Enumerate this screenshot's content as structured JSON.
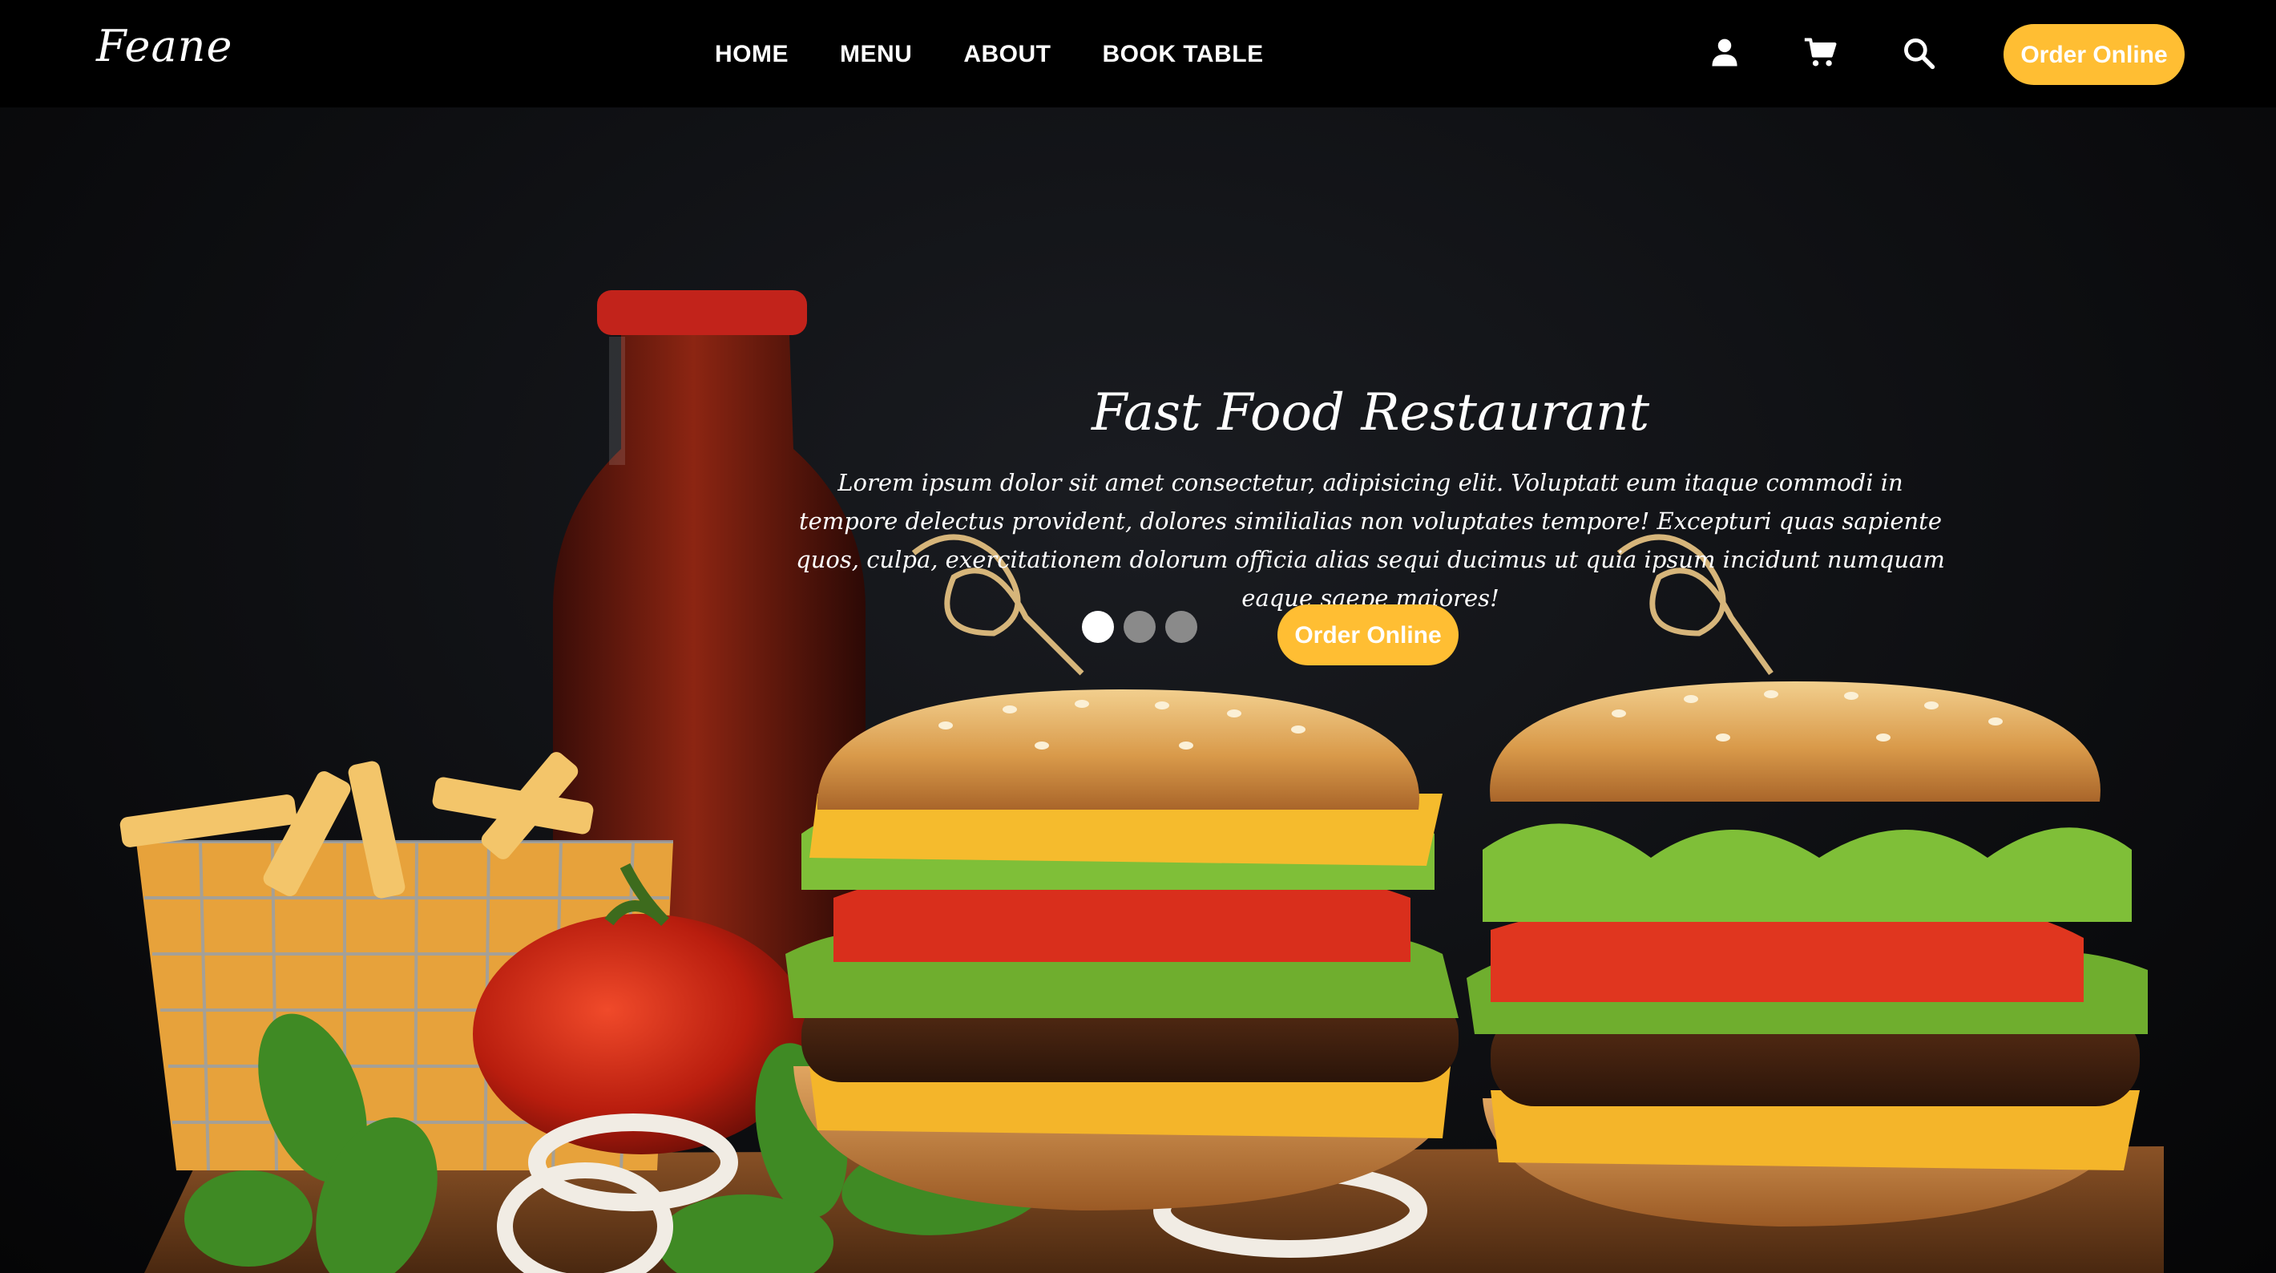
{
  "brand": {
    "name": "Feane"
  },
  "nav": {
    "items": [
      {
        "label": "HOME"
      },
      {
        "label": "MENU"
      },
      {
        "label": "ABOUT"
      },
      {
        "label": "BOOK TABLE"
      }
    ]
  },
  "header": {
    "icons": [
      "user-icon",
      "cart-icon",
      "search-icon"
    ],
    "order_button": "Order Online"
  },
  "hero": {
    "title": "Fast Food Restaurant",
    "description": "Lorem ipsum dolor sit amet consectetur, adipisicing elit. Voluptatt eum itaque commodi in tempore delectus provident, dolores similialias non voluptates tempore! Excepturi quas sapiente quos, culpa, exercitationem dolorum officia alias sequi ducimus ut quia ipsum incidunt numquam eaque saepe maiores!",
    "order_button": "Order Online",
    "carousel": {
      "slide_count": 3,
      "active_index": 0
    }
  },
  "colors": {
    "accent": "#ffbe33",
    "header_bg": "#000000",
    "text": "#ffffff",
    "dot_inactive": "#8a8a8a"
  }
}
